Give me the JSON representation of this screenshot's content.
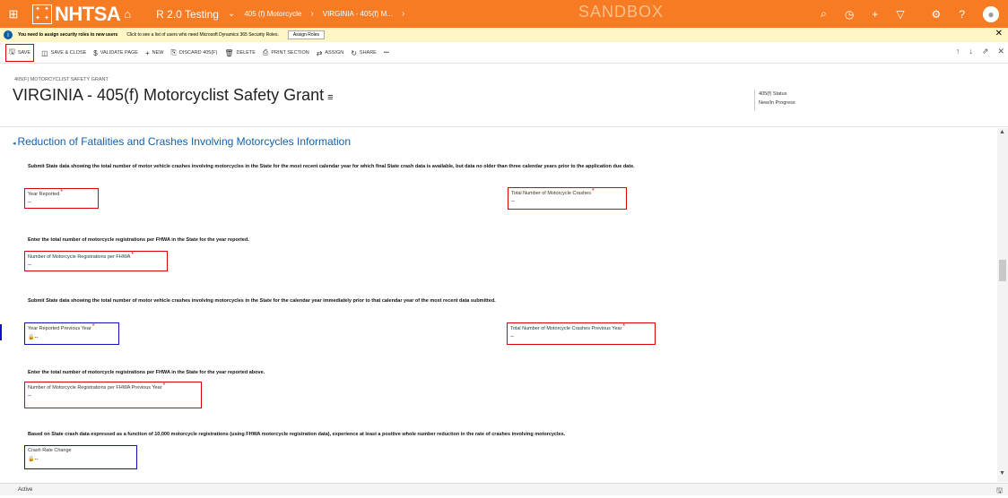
{
  "topbar": {
    "brand": "NHTSA",
    "app_name": "R 2.0 Testing",
    "breadcrumb_1": "405 (f) Motorcycle",
    "breadcrumb_2": "VIRGINIA - 405(f) M...",
    "sandbox": "SANDBOX",
    "color": "#f77b23"
  },
  "notice": {
    "bold_text": "You need to assign security roles to new users",
    "text": "Click to see a list of users who need Microsoft Dynamics 365 Security Roles.",
    "button": "Assign Roles"
  },
  "commands": {
    "save": "SAVE",
    "save_close": "SAVE & CLOSE",
    "validate": "VALIDATE PAGE",
    "new": "NEW",
    "discard": "DISCARD 405(F)",
    "delete": "DELETE",
    "print": "PRINT SECTION",
    "assign": "ASSIGN",
    "share": "SHARE",
    "more": "•••"
  },
  "header": {
    "entity_type": "405(F) MOTORCYCLIST SAFETY GRANT",
    "title": "VIRGINIA - 405(f) Motorcyclist Safety Grant",
    "status_label": "405(f) Status",
    "status_value": "New/In Progress"
  },
  "section": {
    "title": "Reduction of Fatalities and Crashes Involving Motorcycles Information",
    "instr_1": "Submit State data showing the total number of motor vehicle crashes involving motorcycles in the State for the most recent calendar year for which final State crash data is available, but data no older than three calendar years prior to the application due date.",
    "instr_2": "Enter the total number of motorcycle registrations per FHWA in the State for the year reported.",
    "instr_3": "Submit State data showing the total number of motor vehicle crashes involving motorcycles in the State for the calendar year immediately prior to that calendar year of the most recent data submitted.",
    "instr_4": "Enter the total number of motorcycle registrations per FHWA in the State for the year reported above.",
    "instr_5": "Based on State crash data expressed as a function of 10,000 motorcycle registrations (using FHWA motorcycle registration data), experience at least a positive whole number reduction in the rate of crashes involving motorcycles.",
    "fields": {
      "year_reported": {
        "label": "Year Reported",
        "value": "--"
      },
      "total_crashes": {
        "label": "Total Number of Motorcycle Crashes",
        "value": "--"
      },
      "registrations": {
        "label": "Number of Motorcycle Registrations per FHWA",
        "value": "--"
      },
      "year_prev": {
        "label": "Year Reported Previous Year",
        "value": "--"
      },
      "crashes_prev": {
        "label": "Total Number of Motorcycle Crashes Previous Year",
        "value": "--"
      },
      "registrations_prev": {
        "label": "Number of Motorcycle Registrations per FHWA Previous Year",
        "value": "--"
      },
      "crash_rate": {
        "label": "Crash Rate Change",
        "value": "--"
      }
    },
    "required_mark": "*"
  },
  "footer": {
    "status": "Active"
  }
}
